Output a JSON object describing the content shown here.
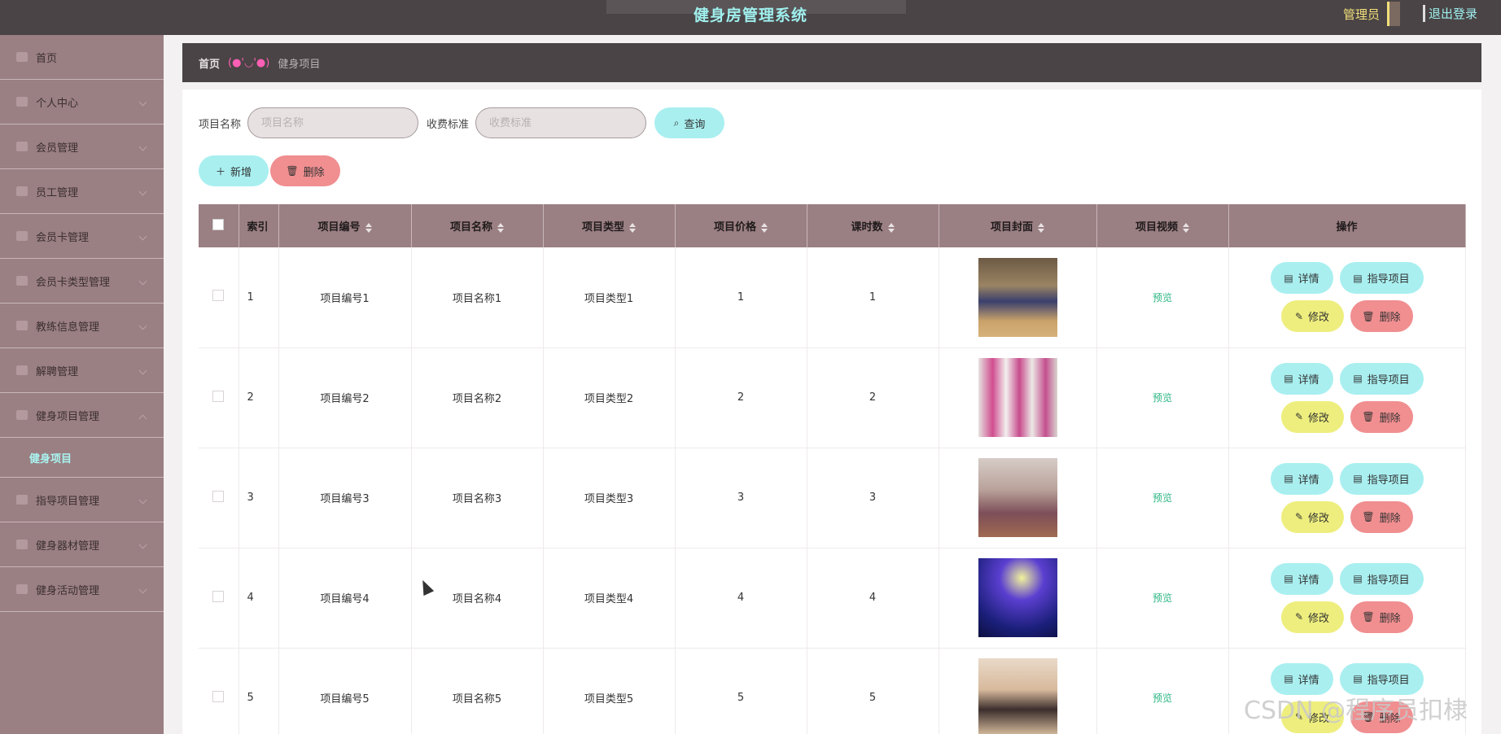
{
  "header": {
    "title": "健身房管理系统",
    "admin_label": "管理员",
    "logout_label": "退出登录"
  },
  "sidebar": {
    "items": [
      {
        "label": "首页",
        "icon": "home-icon",
        "expandable": false
      },
      {
        "label": "个人中心",
        "icon": "user-icon",
        "expandable": true
      },
      {
        "label": "会员管理",
        "icon": "flag-icon",
        "expandable": true
      },
      {
        "label": "员工管理",
        "icon": "id-card-icon",
        "expandable": true
      },
      {
        "label": "会员卡管理",
        "icon": "bank-card-icon",
        "expandable": true
      },
      {
        "label": "会员卡类型管理",
        "icon": "list-icon",
        "expandable": true
      },
      {
        "label": "教练信息管理",
        "icon": "clock-icon",
        "expandable": true
      },
      {
        "label": "解聘管理",
        "icon": "send-icon",
        "expandable": true
      },
      {
        "label": "健身项目管理",
        "icon": "document-icon",
        "expandable": true,
        "expanded": true,
        "sub": "健身项目"
      },
      {
        "label": "指导项目管理",
        "icon": "document-icon",
        "expandable": true
      },
      {
        "label": "健身器材管理",
        "icon": "user-icon",
        "expandable": true
      },
      {
        "label": "健身活动管理",
        "icon": "document-icon",
        "expandable": true
      }
    ]
  },
  "breadcrumb": {
    "home": "首页",
    "emoticon": "(●'◡'●)",
    "current": "健身项目"
  },
  "search": {
    "name_label": "项目名称",
    "name_placeholder": "项目名称",
    "fee_label": "收费标准",
    "fee_placeholder": "收费标准",
    "query_label": "查询"
  },
  "actions": {
    "add_label": "新增",
    "delete_label": "删除"
  },
  "table": {
    "headers": {
      "index": "索引",
      "code": "项目编号",
      "name": "项目名称",
      "type": "项目类型",
      "price": "项目价格",
      "lessons": "课时数",
      "cover": "项目封面",
      "video": "项目视频",
      "ops": "操作"
    },
    "rows": [
      {
        "index": "1",
        "code": "项目编号1",
        "name": "项目名称1",
        "type": "项目类型1",
        "price": "1",
        "lessons": "1",
        "video": "预览"
      },
      {
        "index": "2",
        "code": "项目编号2",
        "name": "项目名称2",
        "type": "项目类型2",
        "price": "2",
        "lessons": "2",
        "video": "预览"
      },
      {
        "index": "3",
        "code": "项目编号3",
        "name": "项目名称3",
        "type": "项目类型3",
        "price": "3",
        "lessons": "3",
        "video": "预览"
      },
      {
        "index": "4",
        "code": "项目编号4",
        "name": "项目名称4",
        "type": "项目类型4",
        "price": "4",
        "lessons": "4",
        "video": "预览"
      },
      {
        "index": "5",
        "code": "项目编号5",
        "name": "项目名称5",
        "type": "项目类型5",
        "price": "5",
        "lessons": "5",
        "video": "预览"
      }
    ],
    "row_actions": {
      "detail": "详情",
      "guide": "指导项目",
      "edit": "修改",
      "delete": "删除"
    }
  },
  "watermark": "CSDN @程序员扣棣",
  "colors": {
    "topbar": "#4a4446",
    "sidebar": "#9a7f83",
    "title": "#9ff0ee",
    "accent_cyan": "#a9eff0",
    "accent_pink": "#f08e90",
    "accent_yellow": "#eeee7e",
    "preview_green": "#2bb683"
  }
}
